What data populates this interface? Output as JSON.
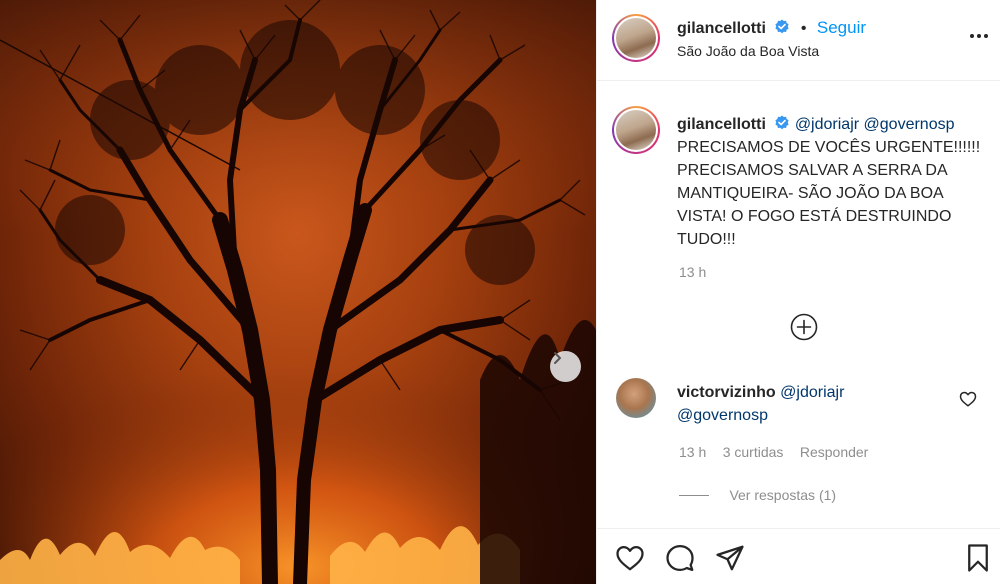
{
  "post": {
    "username": "gilancellotti",
    "follow_label": "Seguir",
    "dot": "•",
    "location": "São João da Boa Vista",
    "more_label": "•••"
  },
  "caption": {
    "username": "gilancellotti",
    "mention_1": "@jdoriajr",
    "mention_2": "@governosp",
    "line_1": "PRECISAMOS DE VOCÊS URGENTE!!!!!!",
    "line_2": "PRECISAMOS SALVAR A SERRA DA",
    "line_3": "MANTIQUEIRA- SÃO JOÃO DA BOA",
    "line_4": "VISTA! O FOGO ESTÁ DESTRUINDO",
    "line_5": "TUDO!!!",
    "time": "13 h"
  },
  "comment": {
    "username": "victorvizinho",
    "mention_1": "@jdoriajr",
    "mention_2": "@governosp",
    "time": "13 h",
    "likes": "3 curtidas",
    "reply": "Responder",
    "view_replies": "Ver respostas (1)"
  },
  "icons": {
    "verified": "verified-badge-icon",
    "more": "more-options-icon",
    "load_more": "plus-circle-icon",
    "next": "chevron-right-icon",
    "heart": "heart-icon",
    "comment": "comment-icon",
    "share": "send-icon",
    "save": "bookmark-icon"
  },
  "colors": {
    "link_blue": "#0095f6",
    "mention": "#00376b",
    "secondary_text": "#8e8e8e",
    "fire_orange": "#c9571c"
  }
}
